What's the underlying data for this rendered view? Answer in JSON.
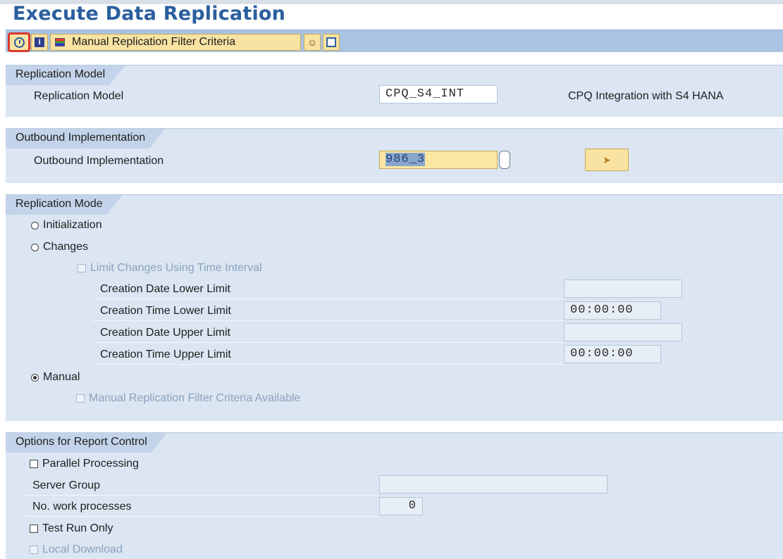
{
  "page": {
    "title": "Execute Data Replication"
  },
  "toolbar": {
    "execute_icon": "execute-clock-icon",
    "info_icon": "info-icon",
    "filter_button_label": "Manual Replication Filter Criteria",
    "variant_icon": "user-variant-icon",
    "export_icon": "export-icon",
    "highlight_color": "#d83a2f"
  },
  "replication_model": {
    "group_title": "Replication Model",
    "label": "Replication Model",
    "value": "CPQ_S4_INT",
    "description": "CPQ Integration with S4 HANA"
  },
  "outbound": {
    "group_title": "Outbound Implementation",
    "label": "Outbound Implementation",
    "value": "986_3",
    "nav_icon": "arrow-right-icon"
  },
  "mode": {
    "group_title": "Replication Mode",
    "initialization": "Initialization",
    "changes": "Changes",
    "limit_changes": "Limit Changes Using Time Interval",
    "date_lower_label": "Creation Date Lower Limit",
    "date_lower_value": "",
    "time_lower_label": "Creation Time Lower Limit",
    "time_lower_value": "00:00:00",
    "date_upper_label": "Creation Date Upper Limit",
    "date_upper_value": "",
    "time_upper_label": "Creation Time Upper Limit",
    "time_upper_value": "00:00:00",
    "manual": "Manual",
    "manual_filter": "Manual Replication Filter Criteria Available",
    "selected": "Manual"
  },
  "report": {
    "group_title": "Options for Report Control",
    "parallel": "Parallel Processing",
    "server_group_label": "Server Group",
    "server_group_value": "",
    "work_processes_label": "No. work processes",
    "work_processes_value": "0",
    "test_run": "Test Run Only",
    "local_download": "Local Download"
  }
}
